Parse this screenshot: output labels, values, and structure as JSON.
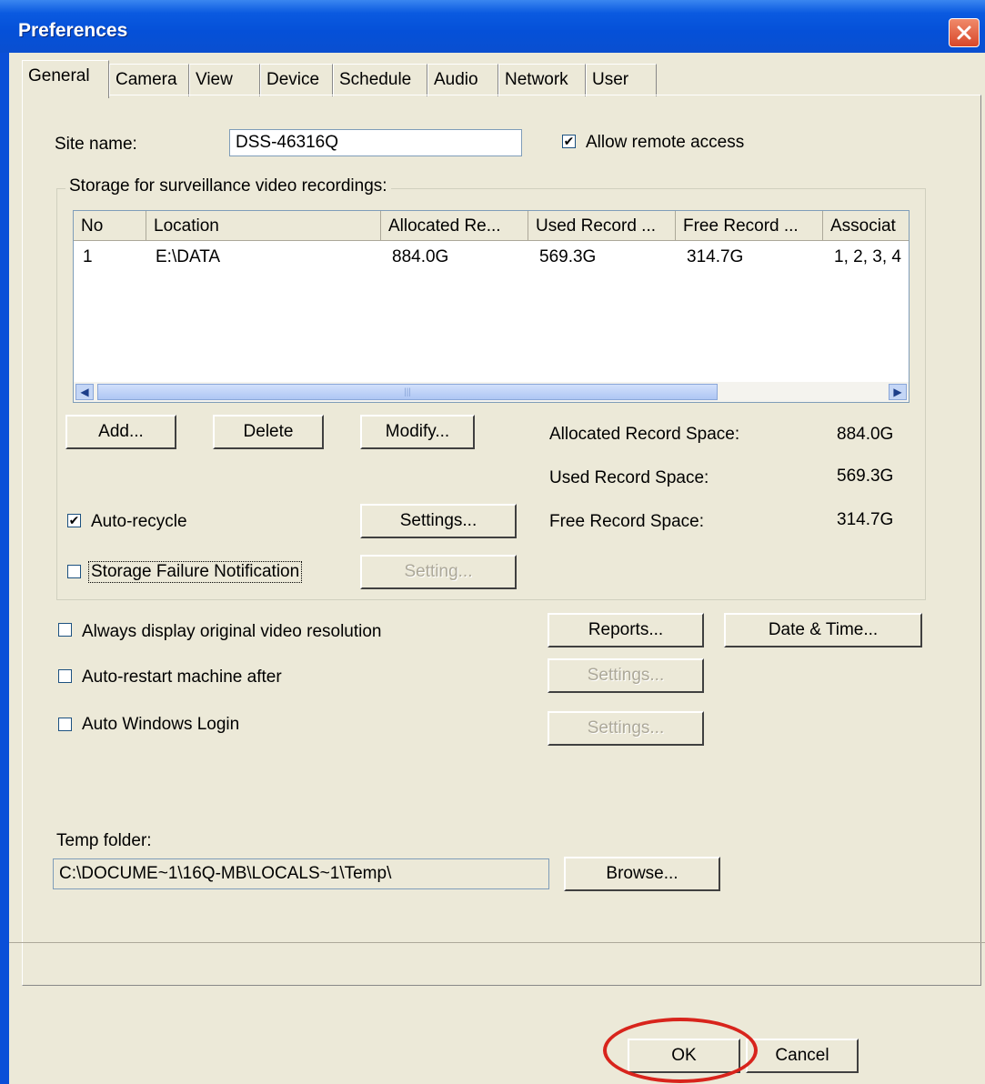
{
  "window": {
    "title": "Preferences"
  },
  "tabs": [
    "General",
    "Camera",
    "View",
    "Device",
    "Schedule",
    "Audio",
    "Network",
    "User"
  ],
  "general": {
    "site_name_label": "Site name:",
    "site_name_value": "DSS-46316Q",
    "allow_remote_label": "Allow remote access",
    "allow_remote_checked": true,
    "storage_group_title": "Storage for surveillance video recordings:",
    "storage_table": {
      "columns": [
        "No",
        "Location",
        "Allocated Re...",
        "Used Record ...",
        "Free Record ...",
        "Associat"
      ],
      "rows": [
        [
          "1",
          "E:\\DATA",
          "884.0G",
          "569.3G",
          "314.7G",
          "1, 2, 3, 4"
        ]
      ]
    },
    "add_button": "Add...",
    "delete_button": "Delete",
    "modify_button": "Modify...",
    "allocated_label": "Allocated Record Space:",
    "allocated_value": "884.0G",
    "used_label": "Used Record Space:",
    "used_value": "569.3G",
    "free_label": "Free Record Space:",
    "free_value": "314.7G",
    "auto_recycle_label": "Auto-recycle",
    "auto_recycle_checked": true,
    "auto_recycle_settings": "Settings...",
    "storage_failure_label": "Storage Failure Notification",
    "storage_failure_checked": false,
    "storage_failure_setting": "Setting...",
    "always_display_label": "Always display original video resolution",
    "reports_button": "Reports...",
    "date_time_button": "Date & Time...",
    "auto_restart_label": "Auto-restart machine after",
    "auto_restart_settings": "Settings...",
    "auto_login_label": "Auto Windows Login",
    "auto_login_settings": "Settings...",
    "temp_folder_label": "Temp folder:",
    "temp_folder_value": "C:\\DOCUME~1\\16Q-MB\\LOCALS~1\\Temp\\",
    "browse_button": "Browse..."
  },
  "footer": {
    "ok_button": "OK",
    "cancel_button": "Cancel"
  },
  "colors": {
    "titlebar": "#0a4fd8",
    "dialog_face": "#ece9d8",
    "highlight_ellipse": "#d8241c"
  }
}
